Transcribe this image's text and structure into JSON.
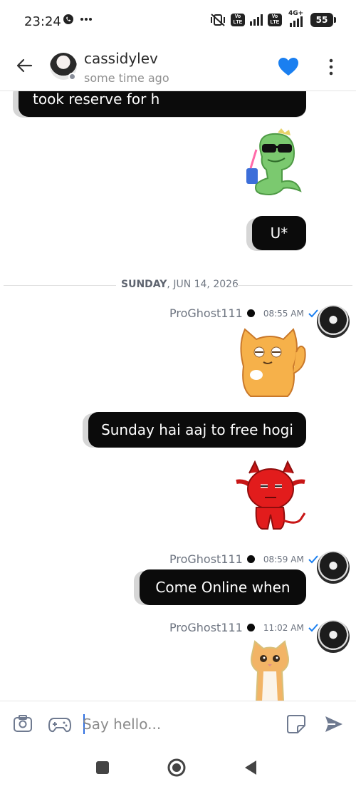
{
  "status_bar": {
    "time": "23:24",
    "network": "4G+",
    "volte_label": "Vo LTE",
    "battery": "55"
  },
  "header": {
    "contact_name": "cassidylev",
    "last_seen": "some time ago",
    "accent_color": "#1a7ff0"
  },
  "messages": {
    "top_bubble": "took reserve for h",
    "u_bubble": "U*",
    "date_separator": {
      "day": "SUNDAY",
      "date": ", JUN 14, 2026"
    },
    "groups": [
      {
        "sender": "ProGhost111",
        "time": "08:55 AM"
      },
      {
        "sender": "ProGhost111",
        "time": "08:59 AM"
      },
      {
        "sender": "ProGhost111",
        "time": "11:02 AM"
      }
    ],
    "sunday_bubble": "Sunday hai aaj to free hogi",
    "online_bubble": "Come Online when",
    "stickers": [
      "dino-sunglasses-sticker",
      "cat-sticker",
      "devil-sticker",
      "kitten-sticker"
    ]
  },
  "composer": {
    "placeholder": "Say hello..."
  },
  "icons": {
    "back": "arrow-left-icon",
    "heart": "heart-icon",
    "more": "more-vertical-icon",
    "camera": "camera-icon",
    "gamepad": "gamepad-icon",
    "sticker": "sticker-icon",
    "send": "send-icon"
  }
}
